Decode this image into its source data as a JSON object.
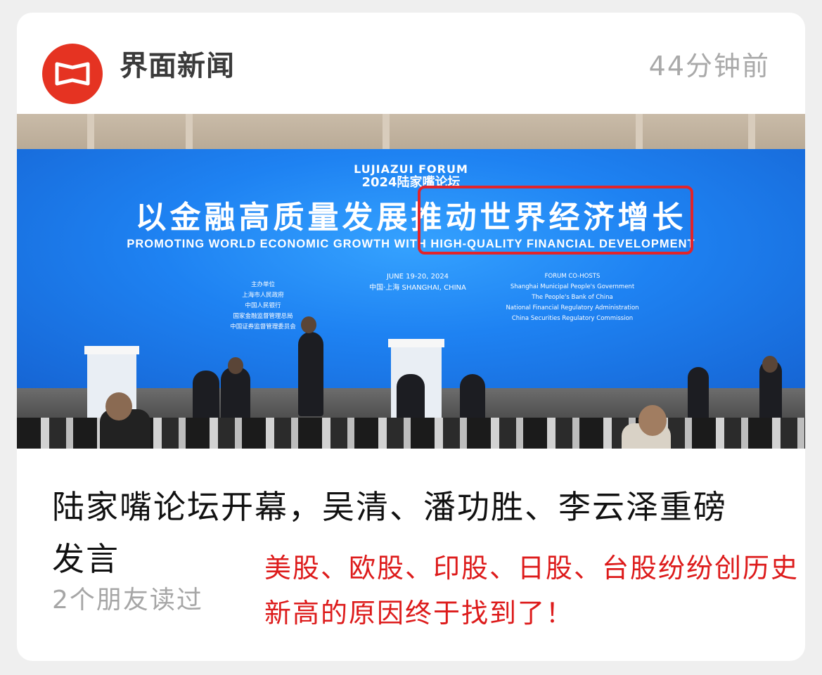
{
  "header": {
    "publisher": "界面新闻",
    "time_ago": "44分钟前"
  },
  "photo": {
    "forum_logo_line1": "LUJIAZUI FORUM",
    "forum_logo_line2": "2024陆家嘴论坛",
    "headline_cn": "以金融高质量发展推动世界经济增长",
    "headline_en": "PROMOTING WORLD ECONOMIC GROWTH WITH HIGH-QUALITY FINANCIAL DEVELOPMENT",
    "hosts_left": [
      "主办单位",
      "上海市人民政府",
      "中国人民银行",
      "国家金融监督管理总局",
      "中国证券监督管理委员会"
    ],
    "date_line": "JUNE 19-20, 2024",
    "location_line": "中国·上海  SHANGHAI, CHINA",
    "hosts_right": [
      "FORUM CO-HOSTS",
      "Shanghai Municipal People's Government",
      "The People's Bank of China",
      "National Financial Regulatory Administration",
      "China Securities Regulatory Commission"
    ],
    "highlight_color": "#e2242a"
  },
  "article": {
    "title": "陆家嘴论坛开幕，吴清、潘功胜、李云泽重磅发言",
    "readers": "2个朋友读过"
  },
  "annotation": {
    "text": "美股、欧股、印股、日股、台股纷纷创历史新高的原因终于找到了！",
    "color": "#dd1b1b"
  },
  "colors": {
    "brand": "#e53322",
    "screen_blue": "#1e82f2"
  }
}
